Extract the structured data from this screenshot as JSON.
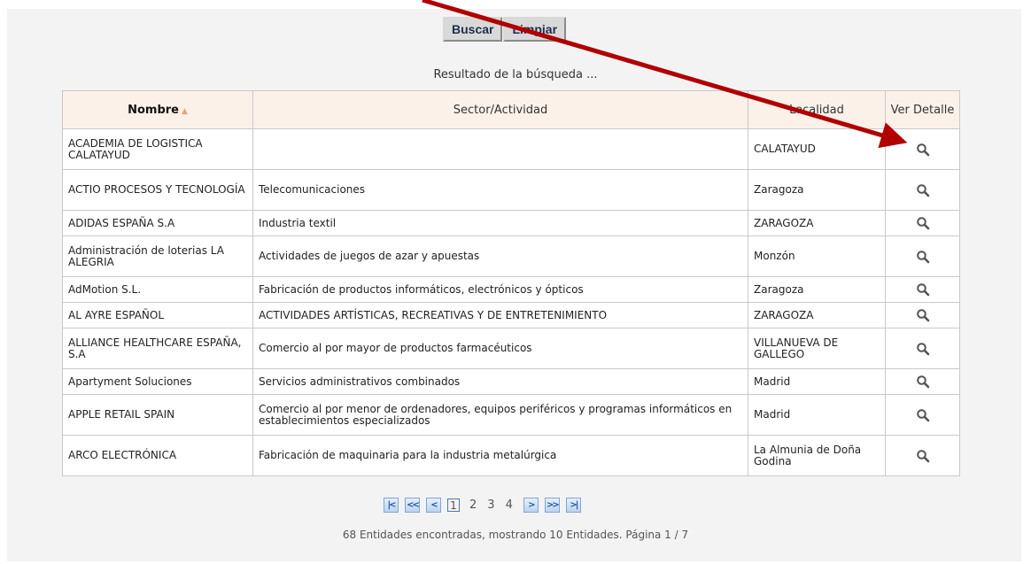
{
  "buttons": {
    "search_label": "Buscar",
    "clear_label": "Limpiar"
  },
  "caption": "Resultado de la búsqueda ...",
  "table": {
    "headers": {
      "name": "Nombre",
      "sector": "Sector/Actividad",
      "locality": "Localidad",
      "detail": "Ver Detalle"
    },
    "rows": [
      {
        "name": "ACADEMIA DE LOGISTICA CALATAYUD",
        "sector": "",
        "locality": "CALATAYUD"
      },
      {
        "name": "ACTIO PROCESOS Y TECNOLOGÍA",
        "sector": "Telecomunicaciones",
        "locality": "Zaragoza"
      },
      {
        "name": "ADIDAS ESPAÑA S.A",
        "sector": "Industria textil",
        "locality": "ZARAGOZA"
      },
      {
        "name": "Administración de loterias LA ALEGRIA",
        "sector": "Actividades de juegos de azar y apuestas",
        "locality": "Monzón"
      },
      {
        "name": "AdMotion S.L.",
        "sector": "Fabricación de productos informáticos, electrónicos y ópticos",
        "locality": "Zaragoza"
      },
      {
        "name": "AL AYRE ESPAÑOL",
        "sector": "ACTIVIDADES ARTÍSTICAS, RECREATIVAS Y DE ENTRETENIMIENTO",
        "locality": "ZARAGOZA"
      },
      {
        "name": "ALLIANCE HEALTHCARE ESPAÑA, S.A",
        "sector": "Comercio al por mayor de productos farmacéuticos",
        "locality": "VILLANUEVA DE GALLEGO"
      },
      {
        "name": "Apartyment Soluciones",
        "sector": "Servicios administrativos combinados",
        "locality": "Madrid"
      },
      {
        "name": "APPLE RETAIL SPAIN",
        "sector": "Comercio al por menor de ordenadores, equipos periféricos y programas informáticos en establecimientos especializados",
        "locality": "Madrid"
      },
      {
        "name": "ARCO ELECTRÓNICA",
        "sector": "Fabricación de maquinaria para la industria metalúrgica",
        "locality": "La Almunia de Doña Godina"
      }
    ]
  },
  "pager": {
    "first": "|<",
    "prev_block": "<<",
    "prev": "<",
    "pages": [
      "1",
      "2",
      "3",
      "4"
    ],
    "current_page": "1",
    "next": ">",
    "next_block": ">>",
    "last": ">|"
  },
  "summary": "68 Entidades encontradas, mostrando 10 Entidades. Página 1 / 7",
  "colors": {
    "annotation_arrow": "#b00000",
    "header_bg": "#fbf1e9",
    "pager_blue": "#1e55b0"
  },
  "icons": {
    "detail": "magnifier-icon",
    "sort": "sort-asc-icon"
  }
}
